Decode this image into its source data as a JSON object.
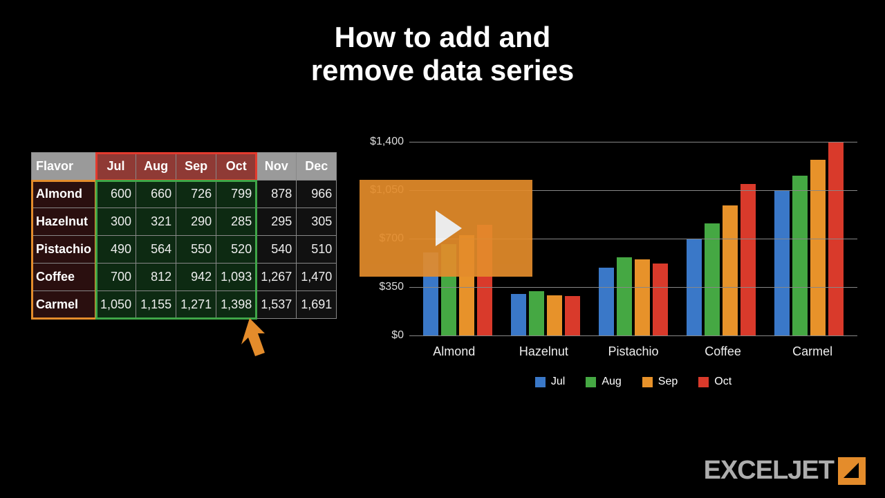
{
  "title_line1": "How to add and",
  "title_line2": "remove data series",
  "table": {
    "corner": "Flavor",
    "months": [
      "Jul",
      "Aug",
      "Sep",
      "Oct",
      "Nov",
      "Dec"
    ],
    "rows": [
      {
        "name": "Almond",
        "vals": [
          "600",
          "660",
          "726",
          "799",
          "878",
          "966"
        ]
      },
      {
        "name": "Hazelnut",
        "vals": [
          "300",
          "321",
          "290",
          "285",
          "295",
          "305"
        ]
      },
      {
        "name": "Pistachio",
        "vals": [
          "490",
          "564",
          "550",
          "520",
          "540",
          "510"
        ]
      },
      {
        "name": "Coffee",
        "vals": [
          "700",
          "812",
          "942",
          "1,093",
          "1,267",
          "1,470"
        ]
      },
      {
        "name": "Carmel",
        "vals": [
          "1,050",
          "1,155",
          "1,271",
          "1,398",
          "1,537",
          "1,691"
        ]
      }
    ],
    "selected_month_count": 4
  },
  "legend": {
    "labels": [
      "Jul",
      "Aug",
      "Sep",
      "Oct"
    ]
  },
  "colors": {
    "series": [
      "#3a78c8",
      "#45a843",
      "#e7922a",
      "#d93a2b"
    ],
    "accent": "#e48c2b"
  },
  "brand": "EXCELJET",
  "chart_data": {
    "type": "bar",
    "title": "",
    "xlabel": "",
    "ylabel": "",
    "ylim": [
      0,
      1400
    ],
    "yticks": [
      "$0",
      "$350",
      "$700",
      "$1,050",
      "$1,400"
    ],
    "categories": [
      "Almond",
      "Hazelnut",
      "Pistachio",
      "Coffee",
      "Carmel"
    ],
    "series": [
      {
        "name": "Jul",
        "values": [
          600,
          300,
          490,
          700,
          1050
        ]
      },
      {
        "name": "Aug",
        "values": [
          660,
          321,
          564,
          812,
          1155
        ]
      },
      {
        "name": "Sep",
        "values": [
          726,
          290,
          550,
          942,
          1271
        ]
      },
      {
        "name": "Oct",
        "values": [
          799,
          285,
          520,
          1093,
          1398
        ]
      }
    ],
    "legend_position": "bottom",
    "grid": true
  }
}
